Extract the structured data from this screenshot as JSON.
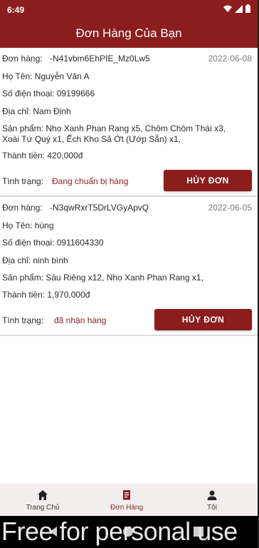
{
  "status_bar": {
    "time": "6:49"
  },
  "app_bar": {
    "title": "Đơn Hàng Của Bạn"
  },
  "orders": [
    {
      "order_label": "Đơn hàng:",
      "order_id": "-N41vbm6EhPIE_Mz0Lw5",
      "date": "2022-06-08",
      "name_line": "Họ Tên: Nguyễn Văn A",
      "phone_line": "Số điện thoại: 09199666",
      "address_line": "Địa chỉ: Nam Định",
      "products_line": "Sản phẩm: Nho Xanh Phan Rang x5, Chôm Chôm Thái x3, Xoài Tứ Quý x1, Ếch Kho Sả Ớt (Ướp Sẵn) x1,",
      "total_line": "Thành tiền: 420,000đ",
      "status_label": "Tình trạng:",
      "status_value": "Đang chuẩn bị hàng",
      "cancel_label": "HỦY ĐƠN"
    },
    {
      "order_label": "Đơn hàng:",
      "order_id": "-N3qwRxrT5DrLVGyApvQ",
      "date": "2022-06-05",
      "name_line": "Họ Tên: hùng",
      "phone_line": "Số điện thoại: 0911604330",
      "address_line": "Địa chỉ: ninh bình",
      "products_line": "Sản phẩm: Sầu Riêng x12, Nho Xanh Phan Rang x1,",
      "total_line": "Thành tiền: 1,970,000đ",
      "status_label": "Tình trạng:",
      "status_value": "đã nhận hàng",
      "cancel_label": "HỦY ĐƠN"
    }
  ],
  "bottom_nav": {
    "items": [
      {
        "label": "Trang Chủ",
        "icon": "home-icon"
      },
      {
        "label": "Đơn Hàng",
        "icon": "receipt-icon"
      },
      {
        "label": "Tôi",
        "icon": "person-icon"
      }
    ]
  },
  "watermark": "Free for personal use",
  "colors": {
    "primary": "#8b1d1d",
    "nav_background": "#f3eeee"
  }
}
